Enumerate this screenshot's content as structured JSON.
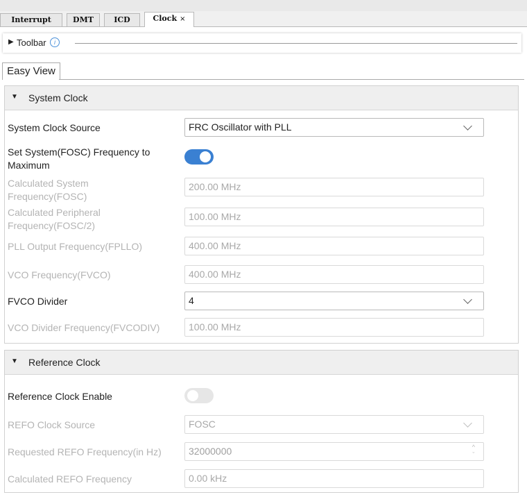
{
  "tabs": [
    {
      "label": "Interrupt"
    },
    {
      "label": "DMT"
    },
    {
      "label": "ICD"
    },
    {
      "label": "Clock",
      "close": "×"
    }
  ],
  "toolbar": {
    "label": "Toolbar",
    "info": "i"
  },
  "view_tab": "Easy View",
  "system_clock": {
    "title": "System Clock",
    "source_label": "System Clock Source",
    "source_value": "FRC Oscillator with PLL",
    "set_max_label": "Set System(FOSC) Frequency to Maximum",
    "set_max_enabled": true,
    "calc_sys_label": "Calculated System Frequency(FOSC)",
    "calc_sys_value": "200.00 MHz",
    "calc_periph_label": "Calculated Peripheral Frequency(FOSC/2)",
    "calc_periph_value": "100.00 MHz",
    "pll_label": "PLL Output Frequency(FPLLO)",
    "pll_value": "400.00 MHz",
    "vco_label": "VCO Frequency(FVCO)",
    "vco_value": "400.00 MHz",
    "fvco_div_label": "FVCO Divider",
    "fvco_div_value": "4",
    "vco_div_freq_label": "VCO Divider Frequency(FVCODIV)",
    "vco_div_freq_value": "100.00 MHz"
  },
  "reference_clock": {
    "title": "Reference Clock",
    "enable_label": "Reference Clock Enable",
    "enabled": false,
    "source_label": "REFO Clock Source",
    "source_value": "FOSC",
    "requested_label": "Requested REFO Frequency(in Hz)",
    "requested_value": "32000000",
    "calc_label": "Calculated REFO Frequency",
    "calc_value": "0.00 kHz"
  },
  "colors": {
    "toggle_on": "#3a80d2",
    "toggle_off": "#e6e6e6",
    "disabled_text": "#b4b4b4"
  }
}
